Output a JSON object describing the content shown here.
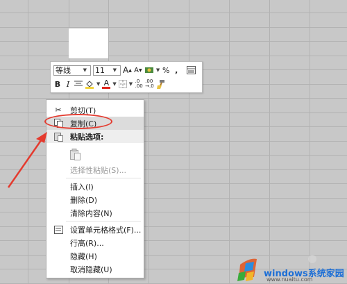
{
  "toolbar": {
    "font_name": "等线",
    "font_size": "11",
    "grow_font": "A",
    "shrink_font": "A",
    "percent": "%",
    "comma": ",",
    "bold": "B",
    "italic": "I",
    "font_color": "A",
    "dec_increase": ".0\n.00",
    "dec_decrease": ".00\n→.0"
  },
  "menu": {
    "cut": "剪切(T)",
    "copy": "复制(C)",
    "paste_options": "粘贴选项:",
    "paste_special": "选择性粘贴(S)...",
    "insert": "插入(I)",
    "delete": "删除(D)",
    "clear": "清除内容(N)",
    "format_cells": "设置单元格格式(F)...",
    "row_height": "行高(R)...",
    "hide": "隐藏(H)",
    "unhide": "取消隐藏(U)"
  },
  "watermark": {
    "brand": "windows系统家园",
    "url": "www.nuaitu.com"
  },
  "colors": {
    "annotation": "#e43a2e",
    "grid_bg": "#c8c8c8",
    "brand_blue": "#1d6fd6"
  },
  "icons": [
    "scissors-icon",
    "copy-icon",
    "paste-icon",
    "clipboard-icon",
    "format-cells-icon",
    "fill-color-icon",
    "font-color-icon",
    "border-icon",
    "format-painter-icon",
    "accounting-icon"
  ]
}
